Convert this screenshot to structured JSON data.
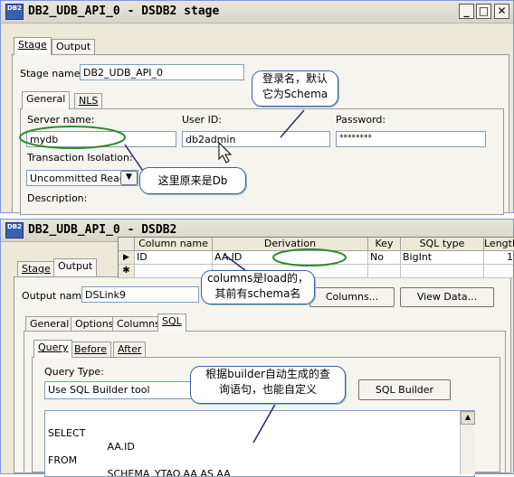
{
  "top_window": {
    "title": "DB2_UDB_API_0 - DSDB2 stage",
    "logo": "DB2",
    "controls": {
      "minimize": "_",
      "maximize": "□",
      "close": "✕"
    },
    "outer_tabs": [
      "Stage",
      "Output"
    ],
    "stage_name_label": "Stage name:",
    "stage_name_value": "DB2_UDB_API_0",
    "inner_tabs": [
      "General",
      "NLS"
    ],
    "server_name_label": "Server name:",
    "server_name_value": "mydb",
    "user_id_label": "User ID:",
    "user_id_value": "db2admin",
    "password_label": "Password:",
    "password_value": "********",
    "isolation_label": "Transaction Isolation:",
    "isolation_value": "Uncommitted Read",
    "description_label": "Description:"
  },
  "callouts": {
    "login": "登录名，默认\n它为Schema",
    "db": "这里原来是Db",
    "columns": "columns是load的，\n其前有schema名",
    "builder": "根据builder自动生成的查\n询语句，也能自定义"
  },
  "bottom_window": {
    "title": "DB2_UDB_API_0 - DSDB2",
    "logo": "DB2",
    "outer_tabs": [
      "Stage",
      "Output"
    ],
    "output_name_label": "Output name:",
    "output_name_value": "DSLink9",
    "columns_button": "Columns...",
    "view_data_button": "View Data...",
    "inner_tabs": [
      "General",
      "Options",
      "Columns",
      "SQL"
    ],
    "sql_tabs": [
      "Query",
      "Before",
      "After"
    ],
    "query_type_label": "Query Type:",
    "query_type_value": "Use SQL Builder tool",
    "sql_builder_button": "SQL Builder",
    "sql_lines": [
      "SELECT",
      "     AA.ID",
      "FROM",
      "     SCHEMA_YTAO.AA AS AA"
    ]
  },
  "column_grid": {
    "headers": [
      "Column name",
      "Derivation",
      "Key",
      "SQL type",
      "Length"
    ],
    "rows": [
      {
        "marker": "▶",
        "column_name": "ID",
        "derivation": "AA.ID",
        "key": "No",
        "sql_type": "BigInt",
        "length": "1"
      },
      {
        "marker": "✱",
        "column_name": "",
        "derivation": "",
        "key": "",
        "sql_type": "",
        "length": ""
      }
    ]
  },
  "colors": {
    "annotation_oval": "#2e8b2e",
    "callout_border": "#3b5ca8",
    "arrow": "#2a2a6a"
  }
}
